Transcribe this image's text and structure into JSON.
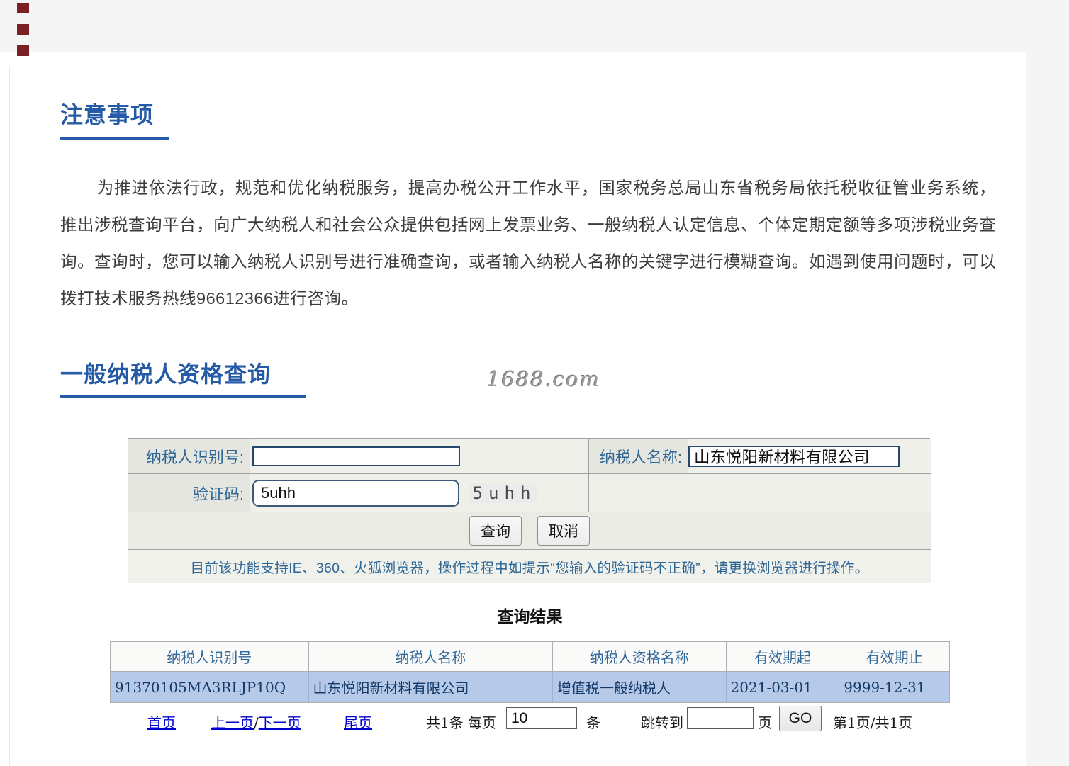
{
  "page": {
    "watermark": "1688.com"
  },
  "notice": {
    "title": "注意事项",
    "paragraph": "为推进依法行政，规范和优化纳税服务，提高办税公开工作水平，国家税务总局山东省税务局依托税收征管业务系统，推出涉税查询平台，向广大纳税人和社会公众提供包括网上发票业务、一般纳税人认定信息、个体定期定额等多项涉税业务查询。查询时，您可以输入纳税人识别号进行准确查询，或者输入纳税人名称的关键字进行模糊查询。如遇到使用问题时，可以拨打技术服务热线96612366进行咨询。"
  },
  "query": {
    "title": "一般纳税人资格查询",
    "form": {
      "taxpayer_id_label": "纳税人识别号:",
      "taxpayer_id_value": "",
      "taxpayer_name_label": "纳税人名称:",
      "taxpayer_name_value": "山东悦阳新材料有限公司",
      "captcha_label": "验证码:",
      "captcha_input_value": "5uhh",
      "captcha_image_text": "5uhh",
      "query_button_label": "查询",
      "cancel_button_label": "取消",
      "browser_note": "目前该功能支持IE、360、火狐浏览器，操作过程中如提示“您输入的验证码不正确”，请更换浏览器进行操作。"
    }
  },
  "results": {
    "title": "查询结果",
    "headers": [
      "纳税人识别号",
      "纳税人名称",
      "纳税人资格名称",
      "有效期起",
      "有效期止"
    ],
    "rows": [
      {
        "taxpayer_id": "91370105MA3RLJP10Q",
        "taxpayer_name": "山东悦阳新材料有限公司",
        "qualification": "增值税一般纳税人",
        "valid_from": "2021-03-01",
        "valid_to": "9999-12-31"
      }
    ]
  },
  "pagination": {
    "first": "首页",
    "prev": "上一页",
    "slash": "/",
    "next": "下一页",
    "last": "尾页",
    "total": "共1条",
    "per_page_label": "每页",
    "per_page_value": "10",
    "per_page_unit": "条",
    "jump_label": "跳转到",
    "jump_value": "",
    "jump_unit": "页",
    "go": "GO",
    "page_info": "第1页/共1页"
  },
  "colors": {
    "accent_blue": "#255aa6",
    "form_label_blue": "#2e6695",
    "link_blue": "#0000cc",
    "result_row_bg": "#b7c9e9",
    "result_row_text": "#123a68",
    "band_gray": "#f5f5f6"
  }
}
